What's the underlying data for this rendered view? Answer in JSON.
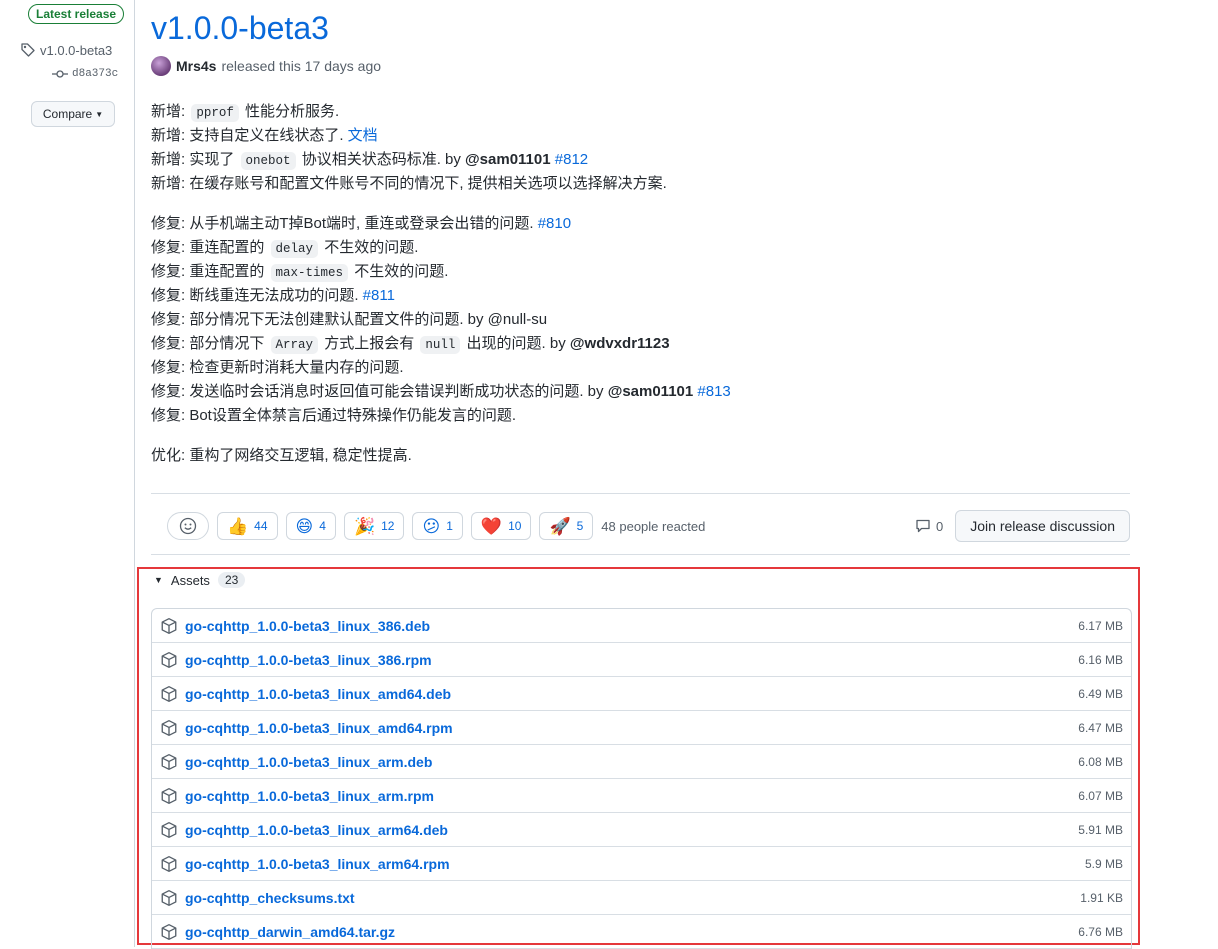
{
  "sidebar": {
    "latest_badge": "Latest release",
    "tag": "v1.0.0-beta3",
    "commit": "d8a373c",
    "compare_label": "Compare"
  },
  "release": {
    "title": "v1.0.0-beta3",
    "author": "Mrs4s",
    "released_text": "released this 17 days ago"
  },
  "notes": {
    "n1_prefix": "新增: ",
    "n1_code": "pprof",
    "n1_suffix": " 性能分析服务.",
    "n2_text": "新增: 支持自定义在线状态了. ",
    "n2_link": "文档",
    "n3_prefix": "新增: 实现了 ",
    "n3_code": "onebot",
    "n3_middle": " 协议相关状态码标准. by ",
    "n3_mention": "@sam01101",
    "n3_issue": "#812",
    "n4_text": "新增: 在缓存账号和配置文件账号不同的情况下, 提供相关选项以选择解决方案.",
    "f1_text": "修复: 从手机端主动T掉Bot端时, 重连或登录会出错的问题. ",
    "f1_issue": "#810",
    "f2_prefix": "修复: 重连配置的 ",
    "f2_code": "delay",
    "f2_suffix": " 不生效的问题.",
    "f3_prefix": "修复: 重连配置的 ",
    "f3_code": "max-times",
    "f3_suffix": " 不生效的问题.",
    "f4_text": "修复: 断线重连无法成功的问题. ",
    "f4_issue": "#811",
    "f5_text": "修复: 部分情况下无法创建默认配置文件的问题. by @null-su",
    "f6_prefix": "修复: 部分情况下 ",
    "f6_code1": "Array",
    "f6_middle": " 方式上报会有 ",
    "f6_code2": "null",
    "f6_suffix": " 出现的问题. by ",
    "f6_mention": "@wdvxdr1123",
    "f7_text": "修复: 检查更新时消耗大量内存的问题.",
    "f8_text": "修复: 发送临时会话消息时返回值可能会错误判断成功状态的问题. by ",
    "f8_mention": "@sam01101",
    "f8_issue": "#813",
    "f9_text": "修复: Bot设置全体禁言后通过特殊操作仍能发言的问题.",
    "o1_text": "优化: 重构了网络交互逻辑, 稳定性提高."
  },
  "reactions": {
    "items": [
      {
        "emoji": "👍",
        "count": "44"
      },
      {
        "emoji": "😄",
        "count": "4"
      },
      {
        "emoji": "🎉",
        "count": "12"
      },
      {
        "emoji": "😕",
        "count": "1"
      },
      {
        "emoji": "❤️",
        "count": "10"
      },
      {
        "emoji": "🚀",
        "count": "5"
      }
    ],
    "summary": "48 people reacted",
    "comments": "0",
    "join_label": "Join release discussion"
  },
  "assets": {
    "heading": "Assets",
    "count": "23",
    "items": [
      {
        "name": "go-cqhttp_1.0.0-beta3_linux_386.deb",
        "size": "6.17 MB"
      },
      {
        "name": "go-cqhttp_1.0.0-beta3_linux_386.rpm",
        "size": "6.16 MB"
      },
      {
        "name": "go-cqhttp_1.0.0-beta3_linux_amd64.deb",
        "size": "6.49 MB"
      },
      {
        "name": "go-cqhttp_1.0.0-beta3_linux_amd64.rpm",
        "size": "6.47 MB"
      },
      {
        "name": "go-cqhttp_1.0.0-beta3_linux_arm.deb",
        "size": "6.08 MB"
      },
      {
        "name": "go-cqhttp_1.0.0-beta3_linux_arm.rpm",
        "size": "6.07 MB"
      },
      {
        "name": "go-cqhttp_1.0.0-beta3_linux_arm64.deb",
        "size": "5.91 MB"
      },
      {
        "name": "go-cqhttp_1.0.0-beta3_linux_arm64.rpm",
        "size": "5.9 MB"
      },
      {
        "name": "go-cqhttp_checksums.txt",
        "size": "1.91 KB"
      },
      {
        "name": "go-cqhttp_darwin_amd64.tar.gz",
        "size": "6.76 MB"
      }
    ]
  },
  "colors": {
    "link": "#0969da",
    "latest_green": "#1a7f37",
    "highlight_red": "#e5383b"
  }
}
